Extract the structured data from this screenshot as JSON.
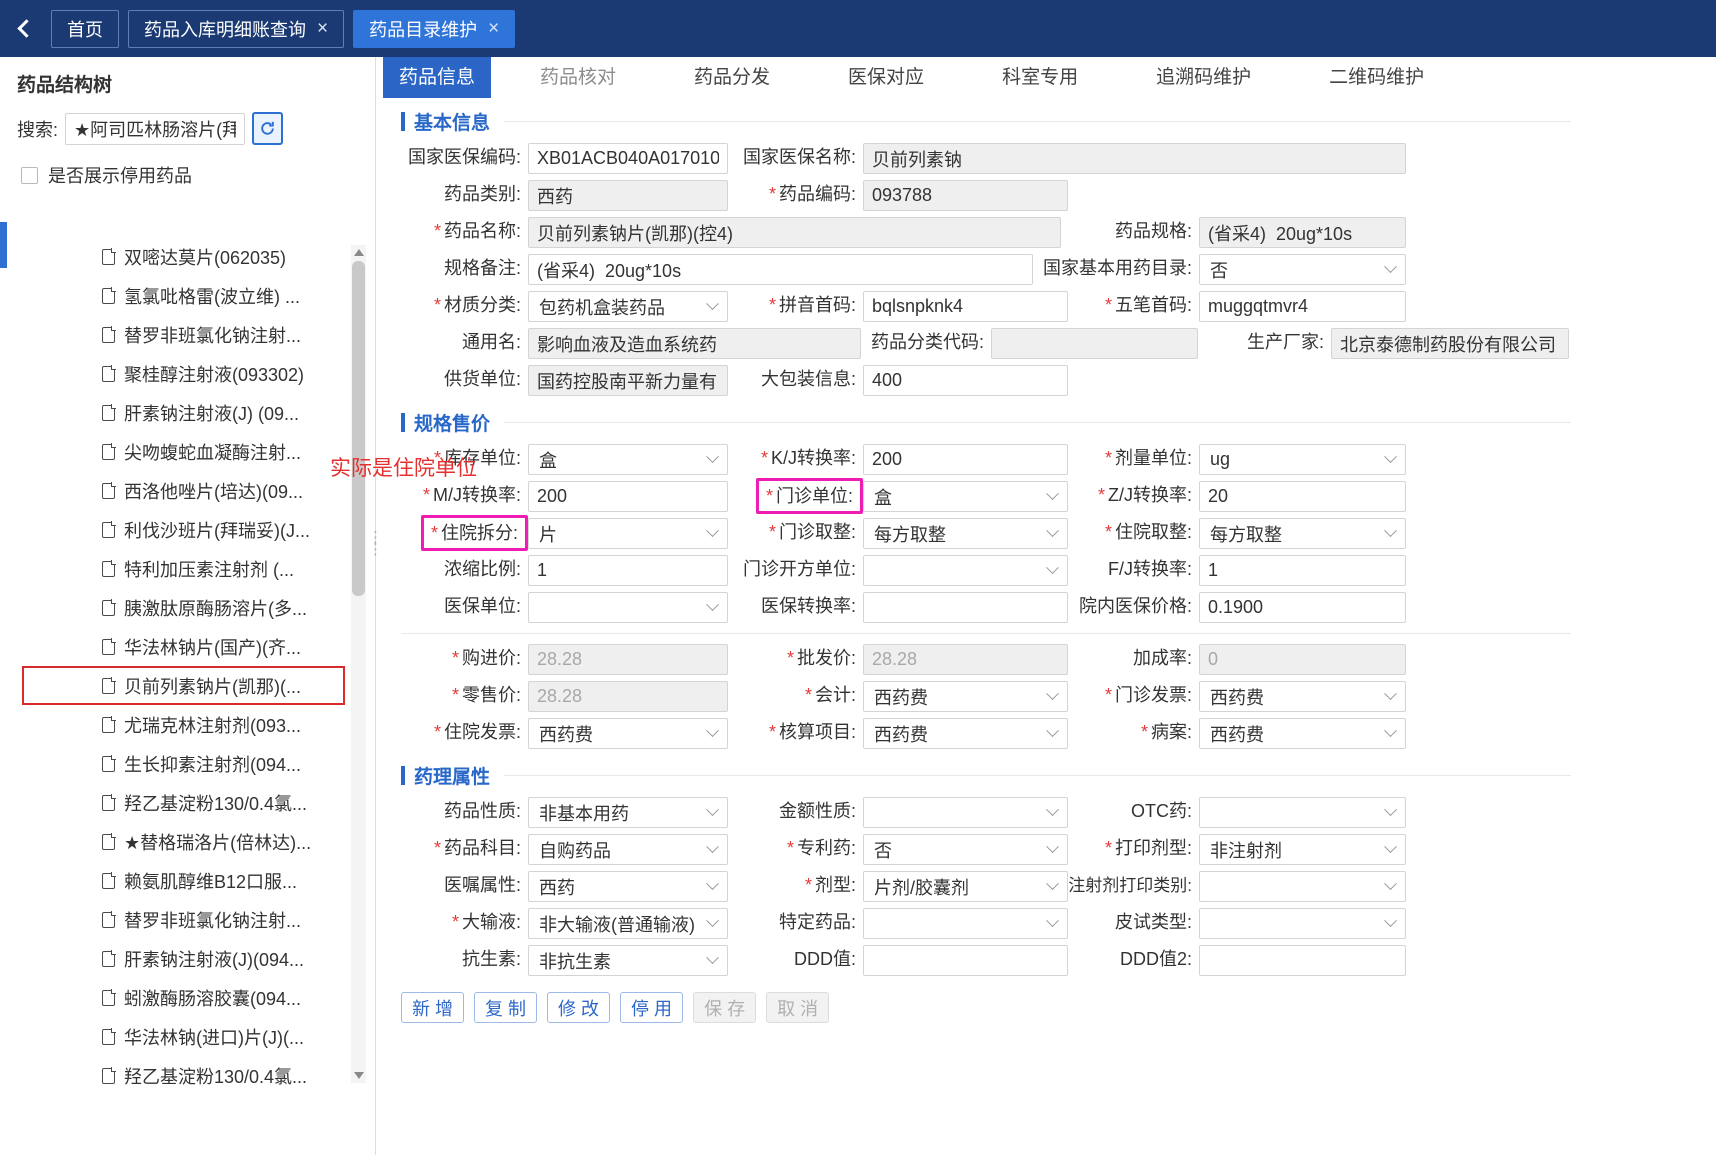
{
  "marks": {
    "required": "*"
  },
  "topbar": {
    "close_glyph": "×",
    "tabs": [
      {
        "label": "首页"
      },
      {
        "label": "药品入库明细账查询"
      },
      {
        "label": "药品目录维护"
      }
    ]
  },
  "sidebar": {
    "title": "药品结构树",
    "search_label": "搜索:",
    "search_value": "★阿司匹林肠溶片(拜",
    "checkbox_label": "是否展示停用药品",
    "tree": [
      "双嘧达莫片(062035)",
      "氢氯吡格雷(波立维) ...",
      "替罗非班氯化钠注射...",
      "聚桂醇注射液(093302)",
      "肝素钠注射液(J) (09...",
      "尖吻蝮蛇血凝酶注射...",
      "西洛他唑片(培达)(09...",
      "利伐沙班片(拜瑞妥)(J...",
      "特利加压素注射剂 (...",
      "胰激肽原酶肠溶片(多...",
      "华法林钠片(国产)(齐...",
      "贝前列素钠片(凯那)(...",
      "尤瑞克林注射剂(093...",
      "生长抑素注射剂(094...",
      "羟乙基淀粉130/0.4氯...",
      "★替格瑞洛片(倍林达)...",
      "赖氨肌醇维B12口服...",
      "替罗非班氯化钠注射...",
      "肝素钠注射液(J)(094...",
      "蚓激酶肠溶胶囊(094...",
      "华法林钠(进口)片(J)(...",
      "羟乙基淀粉130/0.4氯..."
    ]
  },
  "main": {
    "tabs": [
      "药品信息",
      "药品核对",
      "药品分发",
      "医保对应",
      "科室专用",
      "追溯码维护",
      "二维码维护"
    ]
  },
  "sections": {
    "basic": "基本信息",
    "price": "规格售价",
    "pharma": "药理属性"
  },
  "annotations": {
    "note": "实际是住院单位"
  },
  "fields": {
    "nhi_code": {
      "label": "国家医保编码:",
      "value": "XB01ACB040A017010"
    },
    "nhi_name": {
      "label": "国家医保名称:",
      "value": "贝前列素钠"
    },
    "drug_class": {
      "label": "药品类别:",
      "value": "西药"
    },
    "drug_code": {
      "label": "药品编码:",
      "value": "093788"
    },
    "drug_name": {
      "label": "药品名称:",
      "value": "贝前列素钠片(凯那)(控4)"
    },
    "drug_spec": {
      "label": "药品规格:",
      "value": "(省采4)  20ug*10s"
    },
    "spec_note": {
      "label": "规格备注:",
      "value": "(省采4)  20ug*10s"
    },
    "national_catalog": {
      "label": "国家基本用药目录:",
      "value": "否"
    },
    "material_class": {
      "label": "材质分类:",
      "value": "包药机盒装药品"
    },
    "pinyin": {
      "label": "拼音首码:",
      "value": "bqlsnpknk4"
    },
    "wubi": {
      "label": "五笔首码:",
      "value": "muggqtmvr4"
    },
    "generic": {
      "label": "通用名:",
      "value": "影响血液及造血系统药"
    },
    "class_code": {
      "label": "药品分类代码:",
      "value": ""
    },
    "manufacturer": {
      "label": "生产厂家:",
      "value": "北京泰德制药股份有限公司"
    },
    "supplier": {
      "label": "供货单位:",
      "value": "国药控股南平新力量有"
    },
    "package": {
      "label": "大包装信息:",
      "value": "400"
    },
    "stock_unit": {
      "label": "库存单位:",
      "value": "盒"
    },
    "kj": {
      "label": "K/J转换率:",
      "value": "200"
    },
    "dose_unit": {
      "label": "剂量单位:",
      "value": "ug"
    },
    "mj": {
      "label": "M/J转换率:",
      "value": "200"
    },
    "outp_unit": {
      "label": "门诊单位:",
      "value": "盒"
    },
    "zj": {
      "label": "Z/J转换率:",
      "value": "20"
    },
    "inp_split": {
      "label": "住院拆分:",
      "value": "片"
    },
    "outp_round": {
      "label": "门诊取整:",
      "value": "每方取整"
    },
    "inp_round": {
      "label": "住院取整:",
      "value": "每方取整"
    },
    "concentrate": {
      "label": "浓缩比例:",
      "value": "1"
    },
    "outp_rx_unit": {
      "label": "门诊开方单位:",
      "value": ""
    },
    "fj": {
      "label": "F/J转换率:",
      "value": "1"
    },
    "ins_unit": {
      "label": "医保单位:",
      "value": ""
    },
    "ins_rate": {
      "label": "医保转换率:",
      "value": ""
    },
    "ins_price": {
      "label": "院内医保价格:",
      "value": "0.1900"
    },
    "purchase": {
      "label": "购进价:",
      "value": "28.28"
    },
    "wholesale": {
      "label": "批发价:",
      "value": "28.28"
    },
    "markup": {
      "label": "加成率:",
      "value": "0"
    },
    "retail": {
      "label": "零售价:",
      "value": "28.28"
    },
    "accounting": {
      "label": "会计:",
      "value": "西药费"
    },
    "outp_invoice": {
      "label": "门诊发票:",
      "value": "西药费"
    },
    "inp_invoice": {
      "label": "住院发票:",
      "value": "西药费"
    },
    "acc_item": {
      "label": "核算项目:",
      "value": "西药费"
    },
    "med_record": {
      "label": "病案:",
      "value": "西药费"
    },
    "drug_nature": {
      "label": "药品性质:",
      "value": "非基本用药"
    },
    "amount_nature": {
      "label": "金额性质:",
      "value": ""
    },
    "otc": {
      "label": "OTC药:",
      "value": ""
    },
    "drug_subject": {
      "label": "药品科目:",
      "value": "自购药品"
    },
    "patent": {
      "label": "专利药:",
      "value": "否"
    },
    "print_form": {
      "label": "打印剂型:",
      "value": "非注射剂"
    },
    "order_attr": {
      "label": "医嘱属性:",
      "value": "西药"
    },
    "dosage_form": {
      "label": "剂型:",
      "value": "片剂/胶囊剂"
    },
    "inj_print": {
      "label": "注射剂打印类别:",
      "value": ""
    },
    "infusion": {
      "label": "大输液:",
      "value": "非大输液(普通输液)"
    },
    "special": {
      "label": "特定药品:",
      "value": ""
    },
    "skin_test": {
      "label": "皮试类型:",
      "value": ""
    },
    "antibiotic": {
      "label": "抗生素:",
      "value": "非抗生素"
    },
    "ddd": {
      "label": "DDD值:",
      "value": ""
    },
    "ddd2": {
      "label": "DDD值2:",
      "value": ""
    }
  },
  "toolbar": {
    "buttons": [
      "新 增",
      "复 制",
      "修 改",
      "停 用",
      "保 存",
      "取 消"
    ]
  }
}
